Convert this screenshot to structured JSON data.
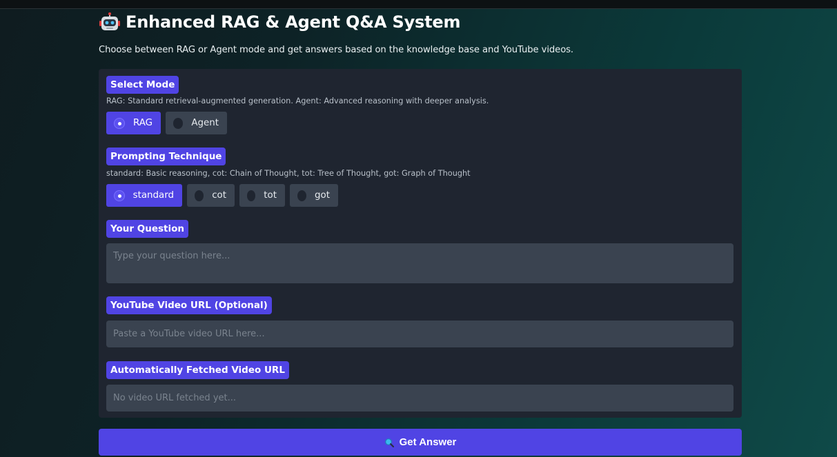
{
  "app": {
    "title": "Enhanced RAG & Agent Q&A System",
    "title_icon": "robot-icon",
    "subtitle": "Choose between RAG or Agent mode and get answers based on the knowledge base and YouTube videos."
  },
  "mode": {
    "label": "Select Mode",
    "info": "RAG: Standard retrieval-augmented generation. Agent: Advanced reasoning with deeper analysis.",
    "options": [
      "RAG",
      "Agent"
    ],
    "selected": "RAG"
  },
  "prompting": {
    "label": "Prompting Technique",
    "info": "standard: Basic reasoning, cot: Chain of Thought, tot: Tree of Thought, got: Graph of Thought",
    "options": [
      "standard",
      "cot",
      "tot",
      "got"
    ],
    "selected": "standard"
  },
  "question": {
    "label": "Your Question",
    "value": "",
    "placeholder": "Type your question here..."
  },
  "youtube_url": {
    "label": "YouTube Video URL (Optional)",
    "value": "",
    "placeholder": "Paste a YouTube video URL here..."
  },
  "fetched_url": {
    "label": "Automatically Fetched Video URL",
    "value": "",
    "placeholder": "No video URL fetched yet..."
  },
  "submit": {
    "label": "Get Answer",
    "icon": "magnifier-icon"
  },
  "colors": {
    "accent": "#5044e4",
    "panel": "#1f2530",
    "input": "#3a4350"
  }
}
